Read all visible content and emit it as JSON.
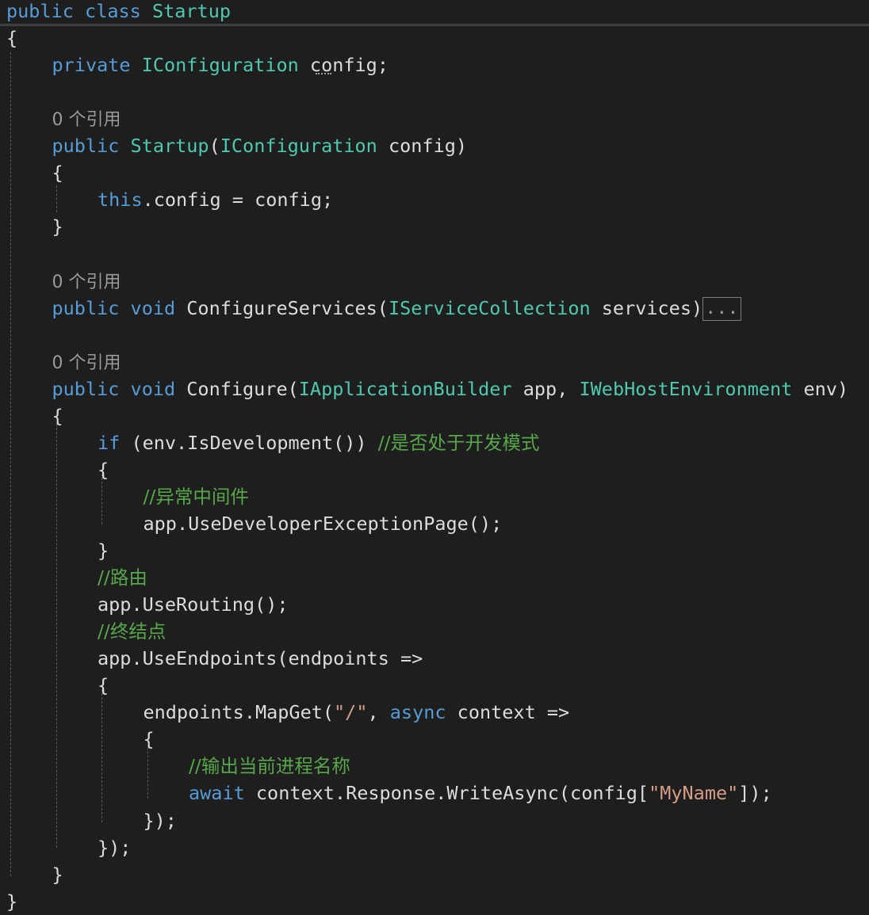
{
  "editor": {
    "lines": [
      {
        "indent": 0,
        "tokens": [
          [
            "kw",
            "public"
          ],
          [
            "id",
            " "
          ],
          [
            "kw",
            "class"
          ],
          [
            "id",
            " "
          ],
          [
            "ty",
            "Startup"
          ]
        ]
      },
      {
        "indent": 0,
        "tokens": [
          [
            "id",
            "{"
          ]
        ]
      },
      {
        "indent": 1,
        "tokens": [
          [
            "kw",
            "private"
          ],
          [
            "id",
            " "
          ],
          [
            "ty",
            "IConfiguration"
          ],
          [
            "id",
            " config;"
          ]
        ]
      },
      {
        "indent": 0,
        "tokens": []
      },
      {
        "indent": 1,
        "tokens": [
          [
            "cl",
            "0 个引用"
          ]
        ]
      },
      {
        "indent": 1,
        "tokens": [
          [
            "kw",
            "public"
          ],
          [
            "id",
            " "
          ],
          [
            "ty",
            "Startup"
          ],
          [
            "id",
            "("
          ],
          [
            "ty",
            "IConfiguration"
          ],
          [
            "id",
            " config)"
          ]
        ]
      },
      {
        "indent": 1,
        "tokens": [
          [
            "id",
            "{"
          ]
        ]
      },
      {
        "indent": 2,
        "tokens": [
          [
            "kw",
            "this"
          ],
          [
            "id",
            ".config = config;"
          ]
        ]
      },
      {
        "indent": 1,
        "tokens": [
          [
            "id",
            "}"
          ]
        ]
      },
      {
        "indent": 0,
        "tokens": []
      },
      {
        "indent": 1,
        "tokens": [
          [
            "cl",
            "0 个引用"
          ]
        ]
      },
      {
        "indent": 1,
        "tokens": [
          [
            "kw",
            "public"
          ],
          [
            "id",
            " "
          ],
          [
            "kw",
            "void"
          ],
          [
            "id",
            " ConfigureServices("
          ],
          [
            "ty",
            "IServiceCollection"
          ],
          [
            "id",
            " services)"
          ],
          [
            "box",
            "..."
          ]
        ]
      },
      {
        "indent": 0,
        "tokens": []
      },
      {
        "indent": 1,
        "tokens": [
          [
            "cl",
            "0 个引用"
          ]
        ]
      },
      {
        "indent": 1,
        "tokens": [
          [
            "kw",
            "public"
          ],
          [
            "id",
            " "
          ],
          [
            "kw",
            "void"
          ],
          [
            "id",
            " Configure("
          ],
          [
            "ty",
            "IApplicationBuilder"
          ],
          [
            "id",
            " app, "
          ],
          [
            "ty",
            "IWebHostEnvironment"
          ],
          [
            "id",
            " env)"
          ]
        ]
      },
      {
        "indent": 1,
        "tokens": [
          [
            "id",
            "{"
          ]
        ]
      },
      {
        "indent": 2,
        "tokens": [
          [
            "kw",
            "if"
          ],
          [
            "id",
            " (env.IsDevelopment()) "
          ],
          [
            "cm",
            "//是否处于开发模式"
          ]
        ]
      },
      {
        "indent": 2,
        "tokens": [
          [
            "id",
            "{"
          ]
        ]
      },
      {
        "indent": 3,
        "tokens": [
          [
            "cm",
            "//异常中间件"
          ]
        ]
      },
      {
        "indent": 3,
        "tokens": [
          [
            "id",
            "app.UseDeveloperExceptionPage();"
          ]
        ]
      },
      {
        "indent": 2,
        "tokens": [
          [
            "id",
            "}"
          ]
        ]
      },
      {
        "indent": 2,
        "tokens": [
          [
            "cm",
            "//路由"
          ]
        ]
      },
      {
        "indent": 2,
        "tokens": [
          [
            "id",
            "app.UseRouting();"
          ]
        ]
      },
      {
        "indent": 2,
        "tokens": [
          [
            "cm",
            "//终结点"
          ]
        ]
      },
      {
        "indent": 2,
        "tokens": [
          [
            "id",
            "app.UseEndpoints(endpoints =>"
          ]
        ]
      },
      {
        "indent": 2,
        "tokens": [
          [
            "id",
            "{"
          ]
        ]
      },
      {
        "indent": 3,
        "tokens": [
          [
            "id",
            "endpoints.MapGet("
          ],
          [
            "st",
            "\"/\""
          ],
          [
            "id",
            ", "
          ],
          [
            "kw",
            "async"
          ],
          [
            "id",
            " context =>"
          ]
        ]
      },
      {
        "indent": 3,
        "tokens": [
          [
            "id",
            "{"
          ]
        ]
      },
      {
        "indent": 4,
        "tokens": [
          [
            "cm",
            "//输出当前进程名称"
          ]
        ]
      },
      {
        "indent": 4,
        "tokens": [
          [
            "kw",
            "await"
          ],
          [
            "id",
            " context.Response.WriteAsync(config["
          ],
          [
            "st",
            "\"MyName\""
          ],
          [
            "id",
            "]);"
          ]
        ]
      },
      {
        "indent": 3,
        "tokens": [
          [
            "id",
            "});"
          ]
        ]
      },
      {
        "indent": 2,
        "tokens": [
          [
            "id",
            "});"
          ]
        ]
      },
      {
        "indent": 1,
        "tokens": [
          [
            "id",
            "}"
          ]
        ]
      },
      {
        "indent": 0,
        "tokens": [
          [
            "id",
            "}"
          ]
        ]
      }
    ]
  },
  "colors": {
    "background": "#1e1e1e",
    "keyword": "#569cd6",
    "type": "#4ec9b0",
    "comment": "#57a64a",
    "string": "#d69d85",
    "text": "#dcdcdc",
    "codelens": "#9a9a9a"
  }
}
